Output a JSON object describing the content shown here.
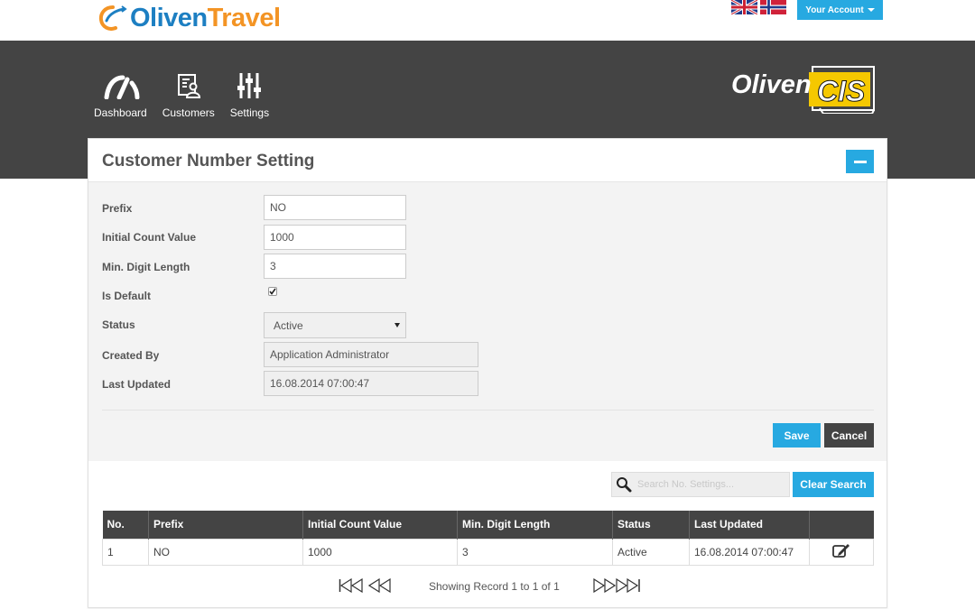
{
  "brand": {
    "name_part1": "Oliven",
    "name_part2": "Travel",
    "cis_logo_text_1": "Oliven",
    "cis_logo_text_2": "CIS"
  },
  "header": {
    "account_label": "Your Account"
  },
  "nav": [
    {
      "label": "Dashboard",
      "icon": "gauge-icon"
    },
    {
      "label": "Customers",
      "icon": "customer-card-icon"
    },
    {
      "label": "Settings",
      "icon": "sliders-icon"
    }
  ],
  "panel": {
    "title": "Customer Number Setting",
    "form": {
      "prefix_label": "Prefix",
      "prefix_value": "NO",
      "initial_count_label": "Initial Count Value",
      "initial_count_value": "1000",
      "min_digit_label": "Min. Digit Length",
      "min_digit_value": "3",
      "is_default_label": "Is Default",
      "is_default_checked": true,
      "status_label": "Status",
      "status_value": "Active",
      "created_by_label": "Created By",
      "created_by_value": "Application Administrator",
      "last_updated_label": "Last Updated",
      "last_updated_value": "16.08.2014 07:00:47"
    },
    "save_label": "Save",
    "cancel_label": "Cancel"
  },
  "search": {
    "placeholder": "Search No. Settings...",
    "clear_label": "Clear Search"
  },
  "table": {
    "headers": [
      "No.",
      "Prefix",
      "Initial Count Value",
      "Min. Digit Length",
      "Status",
      "Last Updated",
      ""
    ],
    "rows": [
      [
        "1",
        "NO",
        "1000",
        "3",
        "Active",
        "16.08.2014 07:00:47"
      ]
    ]
  },
  "pager": {
    "text": "Showing Record 1 to 1 of 1"
  },
  "colors": {
    "accent": "#27a9e1",
    "dark": "#444444",
    "brand_orange": "#f39425",
    "brand_blue": "#1d7fc2",
    "cis_yellow": "#f5c800"
  }
}
